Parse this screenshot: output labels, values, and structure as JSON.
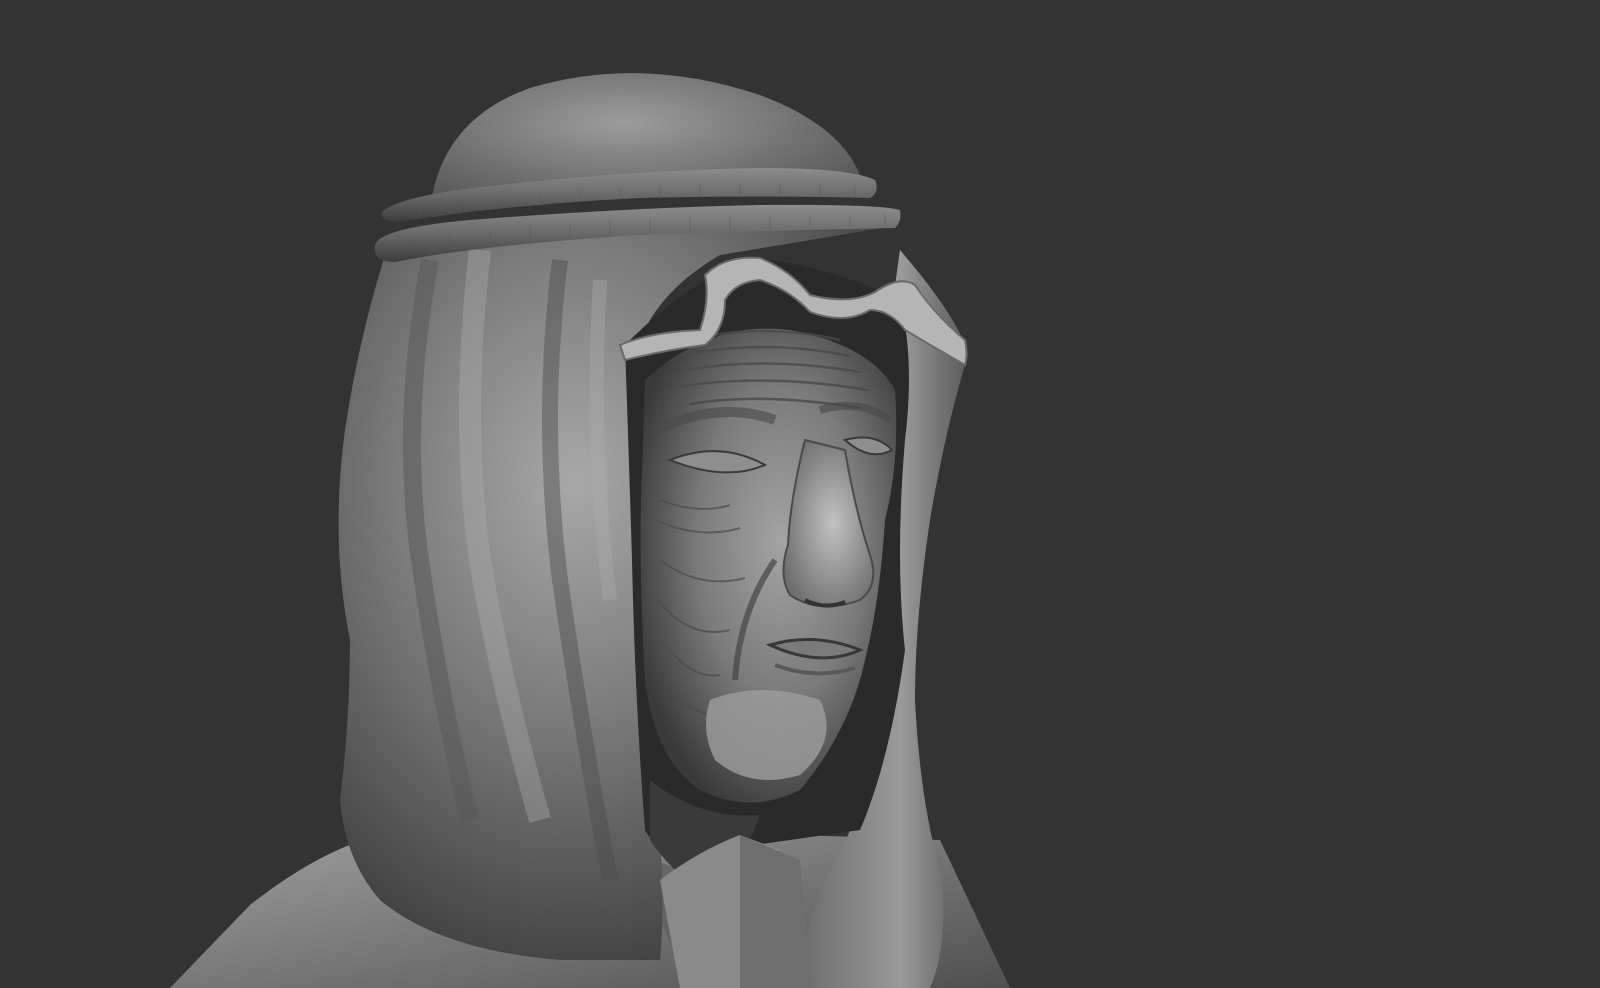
{
  "viewport": {
    "background_color": "#333333",
    "subject": "sculpt-bust",
    "material_colors": {
      "clay_light": "#b9b9b9",
      "clay_mid": "#8a8a8a",
      "clay_dark": "#4a4a4a",
      "shadow": "#1e1e1e"
    }
  }
}
